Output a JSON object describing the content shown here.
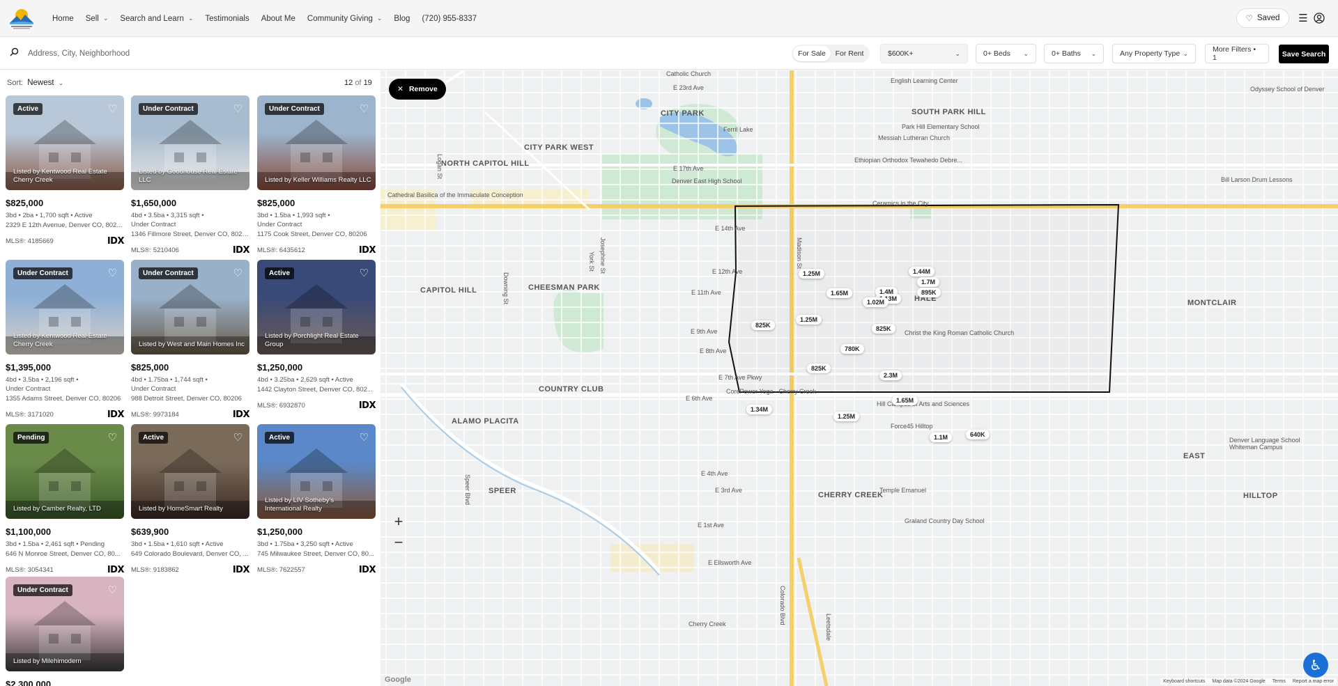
{
  "header": {
    "nav": [
      {
        "label": "Home",
        "dropdown": false
      },
      {
        "label": "Sell",
        "dropdown": true
      },
      {
        "label": "Search and Learn",
        "dropdown": true
      },
      {
        "label": "Testimonials",
        "dropdown": false
      },
      {
        "label": "About Me",
        "dropdown": false
      },
      {
        "label": "Community Giving",
        "dropdown": true
      },
      {
        "label": "Blog",
        "dropdown": false
      },
      {
        "label": "(720) 955-8337",
        "dropdown": false
      }
    ],
    "saved_label": "Saved"
  },
  "filters": {
    "search_placeholder": "Address, City, Neighborhood",
    "for_sale": "For Sale",
    "for_rent": "For Rent",
    "price": "$600K+",
    "beds": "0+ Beds",
    "baths": "0+ Baths",
    "property_type": "Any Property Type",
    "more_filters": "More Filters • 1",
    "save_search": "Save Search"
  },
  "listings_panel": {
    "sort_label": "Sort:",
    "sort_value": "Newest",
    "count_current": "12",
    "count_of": "of",
    "count_total": "19"
  },
  "listings": [
    {
      "status": "Active",
      "listed_by": "Listed by Kentwood Real Estate Cherry Creek",
      "price": "$825,000",
      "info": "3bd • 2ba • 1,700 sqft • Active",
      "info2": "",
      "address": "2329 E 12th Avenue, Denver CO, 802...",
      "mls": "MLS®: 4185669",
      "colors": [
        "#b9c8d8",
        "#8c5a48"
      ]
    },
    {
      "status": "Under Contract",
      "listed_by": "Listed by Goodhouse Real Estate LLC",
      "price": "$1,650,000",
      "info": "4bd • 3.5ba • 3,315 sqft •",
      "info2": "Under Contract",
      "address": "1346 Fillmore Street, Denver CO, 80206",
      "mls": "MLS®: 5210406",
      "colors": [
        "#a8bcd0",
        "#e8e6e2"
      ]
    },
    {
      "status": "Under Contract",
      "listed_by": "Listed by Keller Williams Realty LLC",
      "price": "$825,000",
      "info": "3bd • 1.5ba • 1,993 sqft •",
      "info2": "Under Contract",
      "address": "1175 Cook Street, Denver CO, 80206",
      "mls": "MLS®: 6435612",
      "colors": [
        "#9cb4cc",
        "#8a4a3a"
      ]
    },
    {
      "status": "Under Contract",
      "listed_by": "Listed by Kentwood Real Estate Cherry Creek",
      "price": "$1,395,000",
      "info": "4bd • 3.5ba • 2,196 sqft •",
      "info2": "Under Contract",
      "address": "1355 Adams Street, Denver CO, 80206",
      "mls": "MLS®: 3171020",
      "colors": [
        "#8fb0d6",
        "#d8d0c4"
      ]
    },
    {
      "status": "Under Contract",
      "listed_by": "Listed by West and Main Homes Inc",
      "price": "$825,000",
      "info": "4bd • 1.75ba • 1,744 sqft •",
      "info2": "Under Contract",
      "address": "988 Detroit Street, Denver CO, 80206",
      "mls": "MLS®: 9973184",
      "colors": [
        "#98b0c8",
        "#6a5a48"
      ]
    },
    {
      "status": "Active",
      "listed_by": "Listed by Porchlight Real Estate Group",
      "price": "$1,250,000",
      "info": "4bd • 3.25ba • 2,629 sqft • Active",
      "info2": "",
      "address": "1442 Clayton Street, Denver CO, 802...",
      "mls": "MLS®: 6932870",
      "colors": [
        "#3a4a78",
        "#6a5a52"
      ]
    },
    {
      "status": "Pending",
      "listed_by": "Listed by Camber Realty, LTD",
      "price": "$1,100,000",
      "info": "3bd • 1.5ba • 2,461 sqft • Pending",
      "info2": "",
      "address": "646 N Monroe Street, Denver CO, 80...",
      "mls": "MLS®: 3054341",
      "colors": [
        "#6a8a4a",
        "#3a5a2a"
      ]
    },
    {
      "status": "Active",
      "listed_by": "Listed by HomeSmart Realty",
      "price": "$639,900",
      "info": "3bd • 1.5ba • 1,610 sqft • Active",
      "info2": "",
      "address": "649 Colorado Boulevard, Denver CO, ...",
      "mls": "MLS®: 9183862",
      "colors": [
        "#7a6a5a",
        "#3a2a22"
      ]
    },
    {
      "status": "Active",
      "listed_by": "Listed by LIV Sotheby's International Realty",
      "price": "$1,250,000",
      "info": "3bd • 1.75ba • 3,250 sqft • Active",
      "info2": "",
      "address": "745 Milwaukee Street, Denver CO, 80...",
      "mls": "MLS®: 7622557",
      "colors": [
        "#5a88c8",
        "#8a5a3a"
      ]
    },
    {
      "status": "Under Contract",
      "listed_by": "Listed by Milehimodern",
      "price": "$2,300,000",
      "info": "",
      "info2": "",
      "address": "",
      "mls": "",
      "colors": [
        "#d8b4c0",
        "#3a3a3a"
      ]
    }
  ],
  "map": {
    "remove_label": "Remove",
    "zoom_in": "+",
    "zoom_out": "−",
    "attribution": [
      "Keyboard shortcuts",
      "Map data ©2024 Google",
      "Terms",
      "Report a map error"
    ],
    "google": "Google",
    "pins": [
      {
        "label": "1.25M"
      },
      {
        "label": "1.44M"
      },
      {
        "label": "1.7M"
      },
      {
        "label": "1.65M"
      },
      {
        "label": "1.4M"
      },
      {
        "label": "1.13M"
      },
      {
        "label": "895K"
      },
      {
        "label": "1.02M"
      },
      {
        "label": "1.25M"
      },
      {
        "label": "825K"
      },
      {
        "label": "825K"
      },
      {
        "label": "780K"
      },
      {
        "label": "825K"
      },
      {
        "label": "2.3M"
      },
      {
        "label": "1.65M"
      },
      {
        "label": "1.34M"
      },
      {
        "label": "1.25M"
      },
      {
        "label": "1.1M"
      },
      {
        "label": "640K"
      }
    ],
    "labels": [
      "CITY PARK",
      "SOUTH PARK HILL",
      "CITY PARK WEST",
      "NORTH CAPITOL HILL",
      "CHEESMAN PARK",
      "CAPITOL HILL",
      "HALE",
      "MONTCLAIR",
      "COUNTRY CLUB",
      "ALAMO PLACITA",
      "CHERRY CREEK",
      "SPEER",
      "EAST",
      "HILLTOP",
      "Ferril Lake",
      "Denver East High School",
      "English Learning Center",
      "Park Hill Elementary School",
      "Messiah Lutheran Church",
      "Ethiopian Orthodox Tewahedo Debre...",
      "Bill Larson Drum Lessons",
      "Cathedral Basilica of the Immaculate Conception",
      "Ceramics in the City",
      "Christ the King Roman Catholic Church",
      "CorePower Yoga - Cherry Creek",
      "Hill Campus of Arts and Sciences",
      "Force45 Hilltop",
      "Denver Language School Whiteman Campus",
      "Temple Emanuel",
      "Graland Country Day School",
      "Odyssey School of Denver",
      "Catholic Church",
      "E 23rd Ave",
      "E 17th Ave",
      "E 14th Ave",
      "E 12th Ave",
      "E 11th Ave",
      "E 9th Ave",
      "E 8th Ave",
      "E 7th Ave Pkwy",
      "E 6th Ave",
      "E 4th Ave",
      "E 3rd Ave",
      "E 1st Ave",
      "E Ellsworth Ave",
      "York St",
      "Colorado Blvd",
      "Josephine St",
      "Madison St",
      "Downing St",
      "Logan St",
      "Speer Blvd",
      "Cherry Creek",
      "Leetsdale"
    ]
  }
}
